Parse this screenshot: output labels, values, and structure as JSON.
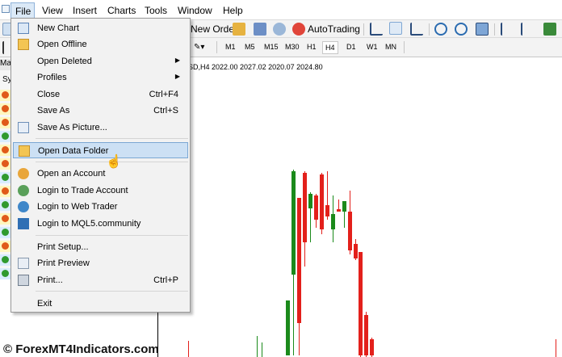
{
  "menubar": [
    "File",
    "View",
    "Insert",
    "Charts",
    "Tools",
    "Window",
    "Help"
  ],
  "toolbar": {
    "new_order": "New Order",
    "auto_trading": "AutoTrading"
  },
  "timeframes": [
    "M1",
    "M5",
    "M15",
    "M30",
    "H1",
    "H4",
    "D1",
    "W1",
    "MN"
  ],
  "active_timeframe": "H4",
  "left_panel": {
    "tab_label": "Ma",
    "header_label": "Sy"
  },
  "chart": {
    "title_fragment": "SD,H4  2022.00  2027.02  2020.07  2024.80",
    "up_color": "#1b8a1b",
    "down_color": "#e3201b"
  },
  "file_menu": {
    "items": [
      {
        "label": "New Chart",
        "shortcut": "",
        "submenu": false,
        "icon": "new-chart-icon"
      },
      {
        "label": "Open Offline",
        "shortcut": "",
        "submenu": false,
        "icon": "folder-icon"
      },
      {
        "label": "Open Deleted",
        "shortcut": "",
        "submenu": true,
        "icon": ""
      },
      {
        "label": "Profiles",
        "shortcut": "",
        "submenu": true,
        "icon": ""
      },
      {
        "label": "Close",
        "shortcut": "Ctrl+F4",
        "submenu": false,
        "icon": ""
      },
      {
        "label": "Save As",
        "shortcut": "Ctrl+S",
        "submenu": false,
        "icon": "save-icon"
      },
      {
        "label": "Save As Picture...",
        "shortcut": "",
        "submenu": false,
        "icon": "picture-icon"
      },
      {
        "label": "Open Data Folder",
        "shortcut": "",
        "submenu": false,
        "icon": "folder-icon"
      },
      {
        "label": "Open an Account",
        "shortcut": "",
        "submenu": false,
        "icon": "account-icon"
      },
      {
        "label": "Login to Trade Account",
        "shortcut": "",
        "submenu": false,
        "icon": "login-icon"
      },
      {
        "label": "Login to Web Trader",
        "shortcut": "",
        "submenu": false,
        "icon": "web-icon"
      },
      {
        "label": "Login to MQL5.community",
        "shortcut": "",
        "submenu": false,
        "icon": "mql5-icon"
      },
      {
        "label": "Print Setup...",
        "shortcut": "",
        "submenu": false,
        "icon": ""
      },
      {
        "label": "Print Preview",
        "shortcut": "",
        "submenu": false,
        "icon": "print-preview-icon"
      },
      {
        "label": "Print...",
        "shortcut": "Ctrl+P",
        "submenu": false,
        "icon": "printer-icon"
      },
      {
        "label": "Exit",
        "shortcut": "",
        "submenu": false,
        "icon": ""
      }
    ],
    "highlighted_index": 7
  },
  "watermark": "© ForexMT4Indicators.com"
}
